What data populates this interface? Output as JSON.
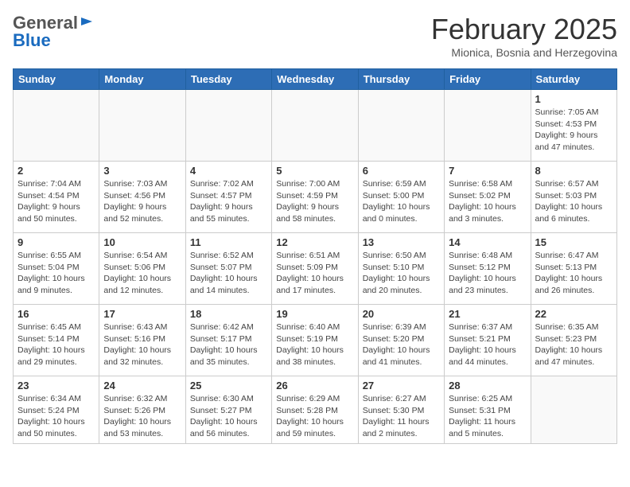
{
  "header": {
    "logo_general": "General",
    "logo_blue": "Blue",
    "month": "February 2025",
    "location": "Mionica, Bosnia and Herzegovina"
  },
  "days_of_week": [
    "Sunday",
    "Monday",
    "Tuesday",
    "Wednesday",
    "Thursday",
    "Friday",
    "Saturday"
  ],
  "weeks": [
    [
      {
        "day": "",
        "info": ""
      },
      {
        "day": "",
        "info": ""
      },
      {
        "day": "",
        "info": ""
      },
      {
        "day": "",
        "info": ""
      },
      {
        "day": "",
        "info": ""
      },
      {
        "day": "",
        "info": ""
      },
      {
        "day": "1",
        "info": "Sunrise: 7:05 AM\nSunset: 4:53 PM\nDaylight: 9 hours and 47 minutes."
      }
    ],
    [
      {
        "day": "2",
        "info": "Sunrise: 7:04 AM\nSunset: 4:54 PM\nDaylight: 9 hours and 50 minutes."
      },
      {
        "day": "3",
        "info": "Sunrise: 7:03 AM\nSunset: 4:56 PM\nDaylight: 9 hours and 52 minutes."
      },
      {
        "day": "4",
        "info": "Sunrise: 7:02 AM\nSunset: 4:57 PM\nDaylight: 9 hours and 55 minutes."
      },
      {
        "day": "5",
        "info": "Sunrise: 7:00 AM\nSunset: 4:59 PM\nDaylight: 9 hours and 58 minutes."
      },
      {
        "day": "6",
        "info": "Sunrise: 6:59 AM\nSunset: 5:00 PM\nDaylight: 10 hours and 0 minutes."
      },
      {
        "day": "7",
        "info": "Sunrise: 6:58 AM\nSunset: 5:02 PM\nDaylight: 10 hours and 3 minutes."
      },
      {
        "day": "8",
        "info": "Sunrise: 6:57 AM\nSunset: 5:03 PM\nDaylight: 10 hours and 6 minutes."
      }
    ],
    [
      {
        "day": "9",
        "info": "Sunrise: 6:55 AM\nSunset: 5:04 PM\nDaylight: 10 hours and 9 minutes."
      },
      {
        "day": "10",
        "info": "Sunrise: 6:54 AM\nSunset: 5:06 PM\nDaylight: 10 hours and 12 minutes."
      },
      {
        "day": "11",
        "info": "Sunrise: 6:52 AM\nSunset: 5:07 PM\nDaylight: 10 hours and 14 minutes."
      },
      {
        "day": "12",
        "info": "Sunrise: 6:51 AM\nSunset: 5:09 PM\nDaylight: 10 hours and 17 minutes."
      },
      {
        "day": "13",
        "info": "Sunrise: 6:50 AM\nSunset: 5:10 PM\nDaylight: 10 hours and 20 minutes."
      },
      {
        "day": "14",
        "info": "Sunrise: 6:48 AM\nSunset: 5:12 PM\nDaylight: 10 hours and 23 minutes."
      },
      {
        "day": "15",
        "info": "Sunrise: 6:47 AM\nSunset: 5:13 PM\nDaylight: 10 hours and 26 minutes."
      }
    ],
    [
      {
        "day": "16",
        "info": "Sunrise: 6:45 AM\nSunset: 5:14 PM\nDaylight: 10 hours and 29 minutes."
      },
      {
        "day": "17",
        "info": "Sunrise: 6:43 AM\nSunset: 5:16 PM\nDaylight: 10 hours and 32 minutes."
      },
      {
        "day": "18",
        "info": "Sunrise: 6:42 AM\nSunset: 5:17 PM\nDaylight: 10 hours and 35 minutes."
      },
      {
        "day": "19",
        "info": "Sunrise: 6:40 AM\nSunset: 5:19 PM\nDaylight: 10 hours and 38 minutes."
      },
      {
        "day": "20",
        "info": "Sunrise: 6:39 AM\nSunset: 5:20 PM\nDaylight: 10 hours and 41 minutes."
      },
      {
        "day": "21",
        "info": "Sunrise: 6:37 AM\nSunset: 5:21 PM\nDaylight: 10 hours and 44 minutes."
      },
      {
        "day": "22",
        "info": "Sunrise: 6:35 AM\nSunset: 5:23 PM\nDaylight: 10 hours and 47 minutes."
      }
    ],
    [
      {
        "day": "23",
        "info": "Sunrise: 6:34 AM\nSunset: 5:24 PM\nDaylight: 10 hours and 50 minutes."
      },
      {
        "day": "24",
        "info": "Sunrise: 6:32 AM\nSunset: 5:26 PM\nDaylight: 10 hours and 53 minutes."
      },
      {
        "day": "25",
        "info": "Sunrise: 6:30 AM\nSunset: 5:27 PM\nDaylight: 10 hours and 56 minutes."
      },
      {
        "day": "26",
        "info": "Sunrise: 6:29 AM\nSunset: 5:28 PM\nDaylight: 10 hours and 59 minutes."
      },
      {
        "day": "27",
        "info": "Sunrise: 6:27 AM\nSunset: 5:30 PM\nDaylight: 11 hours and 2 minutes."
      },
      {
        "day": "28",
        "info": "Sunrise: 6:25 AM\nSunset: 5:31 PM\nDaylight: 11 hours and 5 minutes."
      },
      {
        "day": "",
        "info": ""
      }
    ]
  ]
}
